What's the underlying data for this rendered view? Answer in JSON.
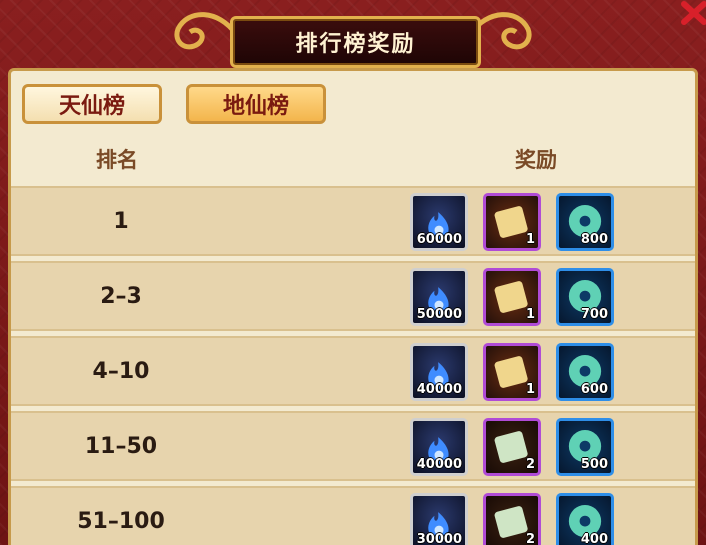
{
  "title": "排行榜奖励",
  "tabs": [
    "天仙榜",
    "地仙榜"
  ],
  "headers": {
    "rank": "排名",
    "reward": "奖励"
  },
  "rows": [
    {
      "rank": "1",
      "rewards": [
        "60000",
        "1",
        "800"
      ]
    },
    {
      "rank": "2–3",
      "rewards": [
        "50000",
        "1",
        "700"
      ]
    },
    {
      "rank": "4–10",
      "rewards": [
        "40000",
        "1",
        "600"
      ]
    },
    {
      "rank": "11–50",
      "rewards": [
        "40000",
        "2",
        "500"
      ]
    },
    {
      "rank": "51–100",
      "rewards": [
        "30000",
        "2",
        "400"
      ]
    }
  ],
  "colors": {
    "frame": "#7a1818",
    "panel": "#f3ead0",
    "row": "#e7d4ad",
    "title_text": "#fff2d2"
  }
}
